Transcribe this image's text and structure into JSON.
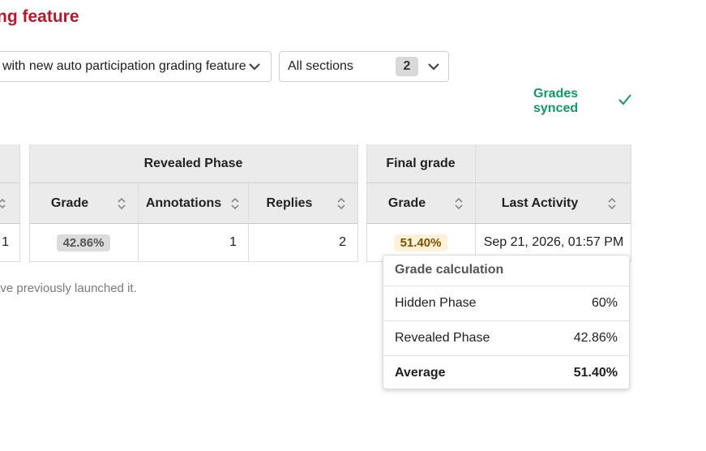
{
  "header": {
    "title": "ng feature"
  },
  "filters": {
    "assignment_select": "with new auto participation grading feature",
    "section_select": "All sections",
    "section_count": "2"
  },
  "sync": {
    "status": "Grades synced",
    "icon": "check-icon"
  },
  "table": {
    "groups": {
      "revealed_phase": "Revealed Phase",
      "final_grade": "Final grade"
    },
    "columns": {
      "revealed_grade": "Grade",
      "annotations": "Annotations",
      "replies": "Replies",
      "final_grade": "Grade",
      "last_activity": "Last Activity"
    },
    "row": {
      "partial_value": "1",
      "revealed_grade": "42.86%",
      "annotations": "1",
      "replies": "2",
      "final_grade": "51.40%",
      "last_activity": "Sep 21, 2026, 01:57 PM"
    }
  },
  "footnote": "ave previously launched it.",
  "popover": {
    "title": "Grade calculation",
    "rows": [
      {
        "label": "Hidden Phase",
        "value": "60%"
      },
      {
        "label": "Revealed Phase",
        "value": "42.86%"
      },
      {
        "label": "Average",
        "value": "51.40%"
      }
    ]
  },
  "colors": {
    "title": "#b5172b",
    "synced": "#119a62",
    "header_bg": "#ebebeb"
  }
}
